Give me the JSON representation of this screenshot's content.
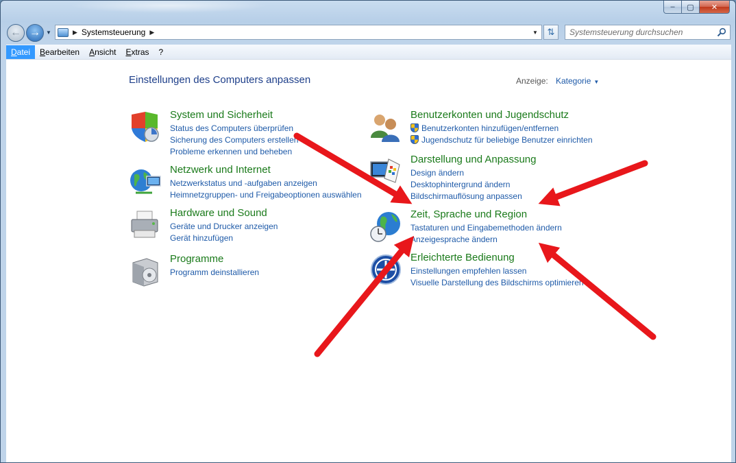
{
  "window": {
    "caption_min": "–",
    "caption_max": "▢",
    "caption_close": "✕"
  },
  "navigation": {
    "breadcrumb": "Systemsteuerung",
    "search_placeholder": "Systemsteuerung durchsuchen"
  },
  "menu": {
    "items": [
      {
        "label": "Datei",
        "active": true
      },
      {
        "label": "Bearbeiten"
      },
      {
        "label": "Ansicht"
      },
      {
        "label": "Extras"
      },
      {
        "label": "?"
      }
    ]
  },
  "page": {
    "title": "Einstellungen des Computers anpassen",
    "view_label": "Anzeige:",
    "view_value": "Kategorie"
  },
  "categories": {
    "system": {
      "title": "System und Sicherheit",
      "links": [
        "Status des Computers überprüfen",
        "Sicherung des Computers erstellen",
        "Probleme erkennen und beheben"
      ]
    },
    "network": {
      "title": "Netzwerk und Internet",
      "links": [
        "Netzwerkstatus und -aufgaben anzeigen",
        "Heimnetzgruppen- und Freigabeoptionen auswählen"
      ]
    },
    "hardware": {
      "title": "Hardware und Sound",
      "links": [
        "Geräte und Drucker anzeigen",
        "Gerät hinzufügen"
      ]
    },
    "programs": {
      "title": "Programme",
      "links": [
        "Programm deinstallieren"
      ]
    },
    "accounts": {
      "title": "Benutzerkonten und Jugendschutz",
      "links": [
        "Benutzerkonten hinzufügen/entfernen",
        "Jugendschutz für beliebige Benutzer einrichten"
      ]
    },
    "appearance": {
      "title": "Darstellung und Anpassung",
      "links": [
        "Design ändern",
        "Desktophintergrund ändern",
        "Bildschirmauflösung anpassen"
      ]
    },
    "region": {
      "title": "Zeit, Sprache und Region",
      "links": [
        "Tastaturen und Eingabemethoden ändern",
        "Anzeigesprache ändern"
      ]
    },
    "ease": {
      "title": "Erleichterte Bedienung",
      "links": [
        "Einstellungen empfehlen lassen",
        "Visuelle Darstellung des Bildschirms optimieren"
      ]
    }
  },
  "annotations": {
    "arrow_color": "#e8171b"
  }
}
